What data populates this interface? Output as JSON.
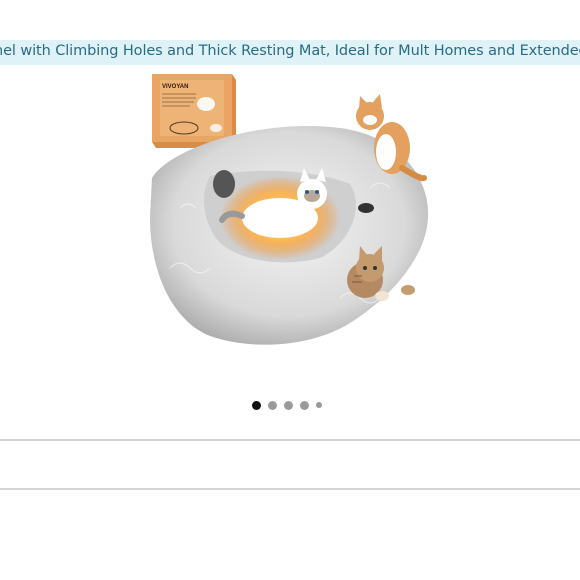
{
  "product": {
    "title": "nel with Climbing Holes and Thick Resting Mat, Ideal for Mult Homes and Extended Playtime",
    "box_brand": "VIVOYAN"
  },
  "carousel": {
    "total": 5,
    "active_index": 0
  },
  "colors": {
    "title_bg": "#dff2f8",
    "title_text": "#2a6b84",
    "active_dot": "#111111",
    "inactive_dot": "#9a9a9a"
  }
}
